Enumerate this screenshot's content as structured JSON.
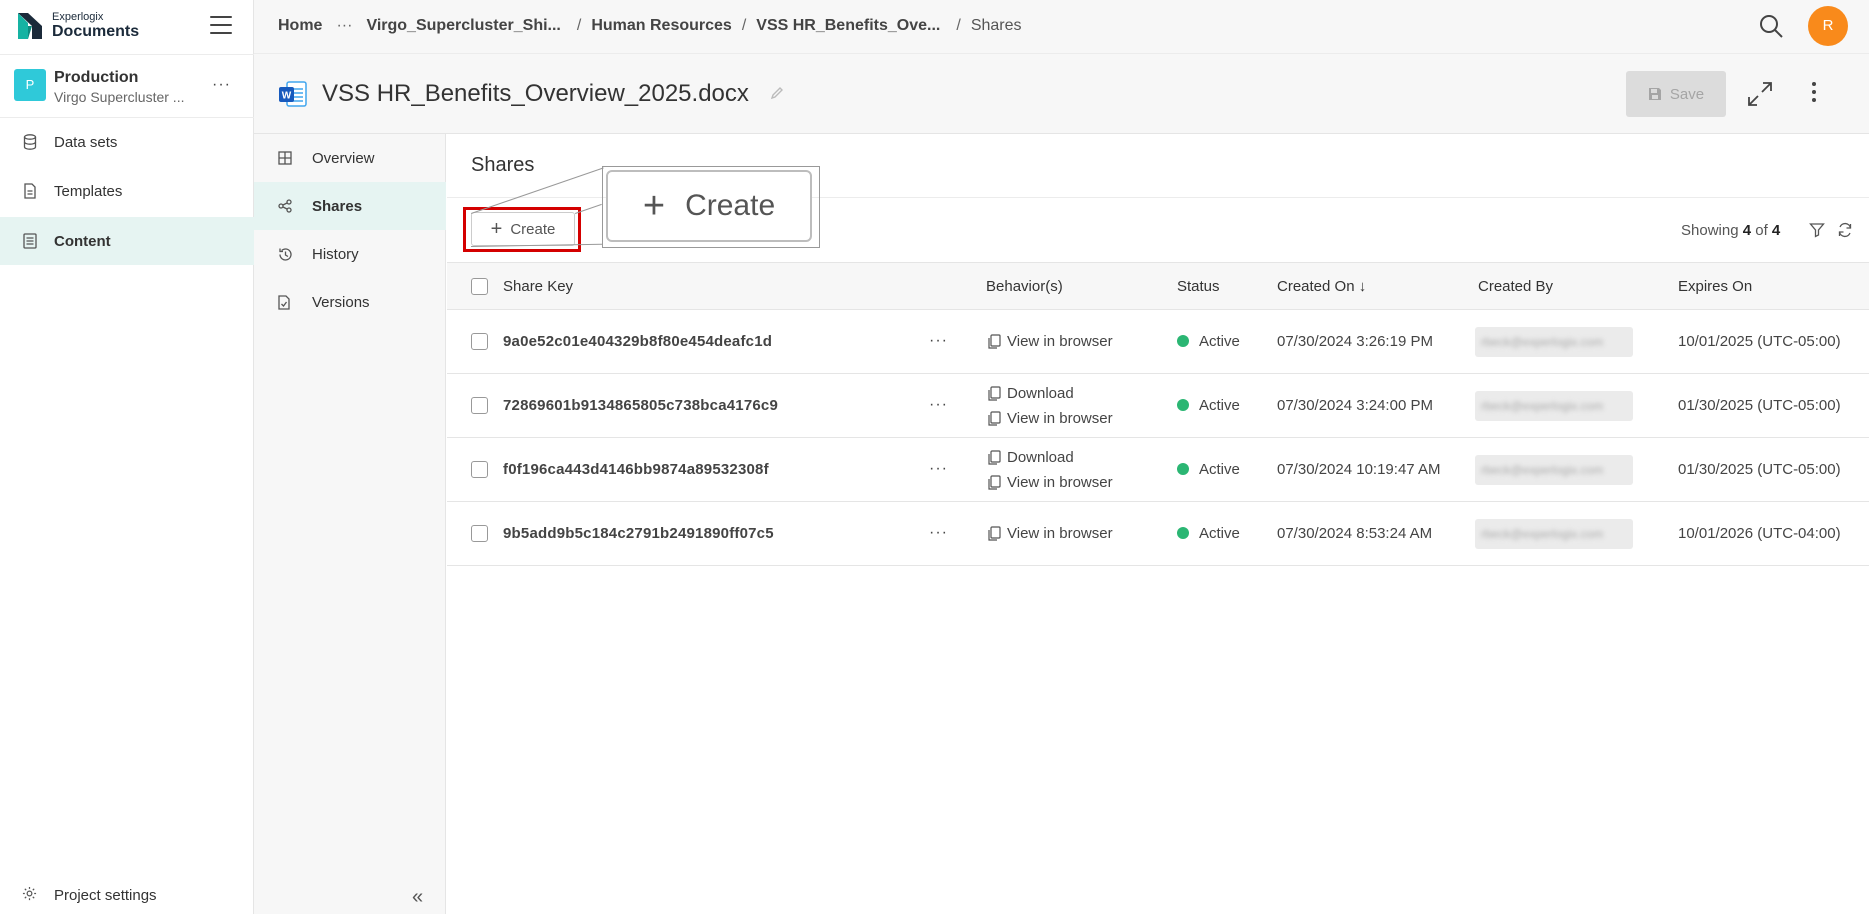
{
  "brand": {
    "small": "Experlogix",
    "big": "Documents"
  },
  "project": {
    "avatar": "P",
    "name": "Production",
    "subtitle": "Virgo Supercluster ..."
  },
  "sidebar": {
    "items": [
      {
        "label": "Data sets",
        "icon": "database-icon"
      },
      {
        "label": "Templates",
        "icon": "file-icon"
      },
      {
        "label": "Content",
        "icon": "content-icon",
        "active": true
      }
    ],
    "settings_label": "Project settings"
  },
  "breadcrumb": {
    "home": "Home",
    "ellipsis": "···",
    "c1": "Virgo_Supercluster_Shi...",
    "c2": "Human Resources",
    "c3": "VSS HR_Benefits_Ove...",
    "current": "Shares",
    "sep": "/"
  },
  "user": {
    "initial": "R"
  },
  "document": {
    "title": "VSS HR_Benefits_Overview_2025.docx",
    "save_label": "Save"
  },
  "subnav": {
    "items": [
      {
        "label": "Overview"
      },
      {
        "label": "Shares",
        "active": true
      },
      {
        "label": "History"
      },
      {
        "label": "Versions"
      }
    ]
  },
  "shares": {
    "title": "Shares",
    "create_label": "Create",
    "showing": {
      "prefix": "Showing",
      "count": "4",
      "of": "of",
      "total": "4"
    },
    "columns": {
      "share_key": "Share Key",
      "behaviors": "Behavior(s)",
      "status": "Status",
      "created_on": "Created On ↓",
      "created_by": "Created By",
      "expires_on": "Expires On"
    },
    "rows": [
      {
        "key": "9a0e52c01e404329b8f80e454deafc1d",
        "behaviors": [
          "View in browser"
        ],
        "status": "Active",
        "created_on": "07/30/2024 3:26:19 PM",
        "created_by": "rbeck@experlogix.com",
        "expires_on": "10/01/2025 (UTC-05:00)"
      },
      {
        "key": "72869601b9134865805c738bca4176c9",
        "behaviors": [
          "Download",
          "View in browser"
        ],
        "status": "Active",
        "created_on": "07/30/2024 3:24:00 PM",
        "created_by": "rbeck@experlogix.com",
        "expires_on": "01/30/2025 (UTC-05:00)"
      },
      {
        "key": "f0f196ca443d4146bb9874a89532308f",
        "behaviors": [
          "Download",
          "View in browser"
        ],
        "status": "Active",
        "created_on": "07/30/2024 10:19:47 AM",
        "created_by": "rbeck@experlogix.com",
        "expires_on": "01/30/2025 (UTC-05:00)"
      },
      {
        "key": "9b5add9b5c184c2791b2491890ff07c5",
        "behaviors": [
          "View in browser"
        ],
        "status": "Active",
        "created_on": "07/30/2024 8:53:24 AM",
        "created_by": "rbeck@experlogix.com",
        "expires_on": "10/01/2026 (UTC-04:00)"
      }
    ]
  },
  "colors": {
    "accent": "#2fc9d9",
    "active_bg": "#e6f4f2",
    "status_active": "#2bb673",
    "avatar": "#f98a1b",
    "highlight": "#d40000"
  }
}
